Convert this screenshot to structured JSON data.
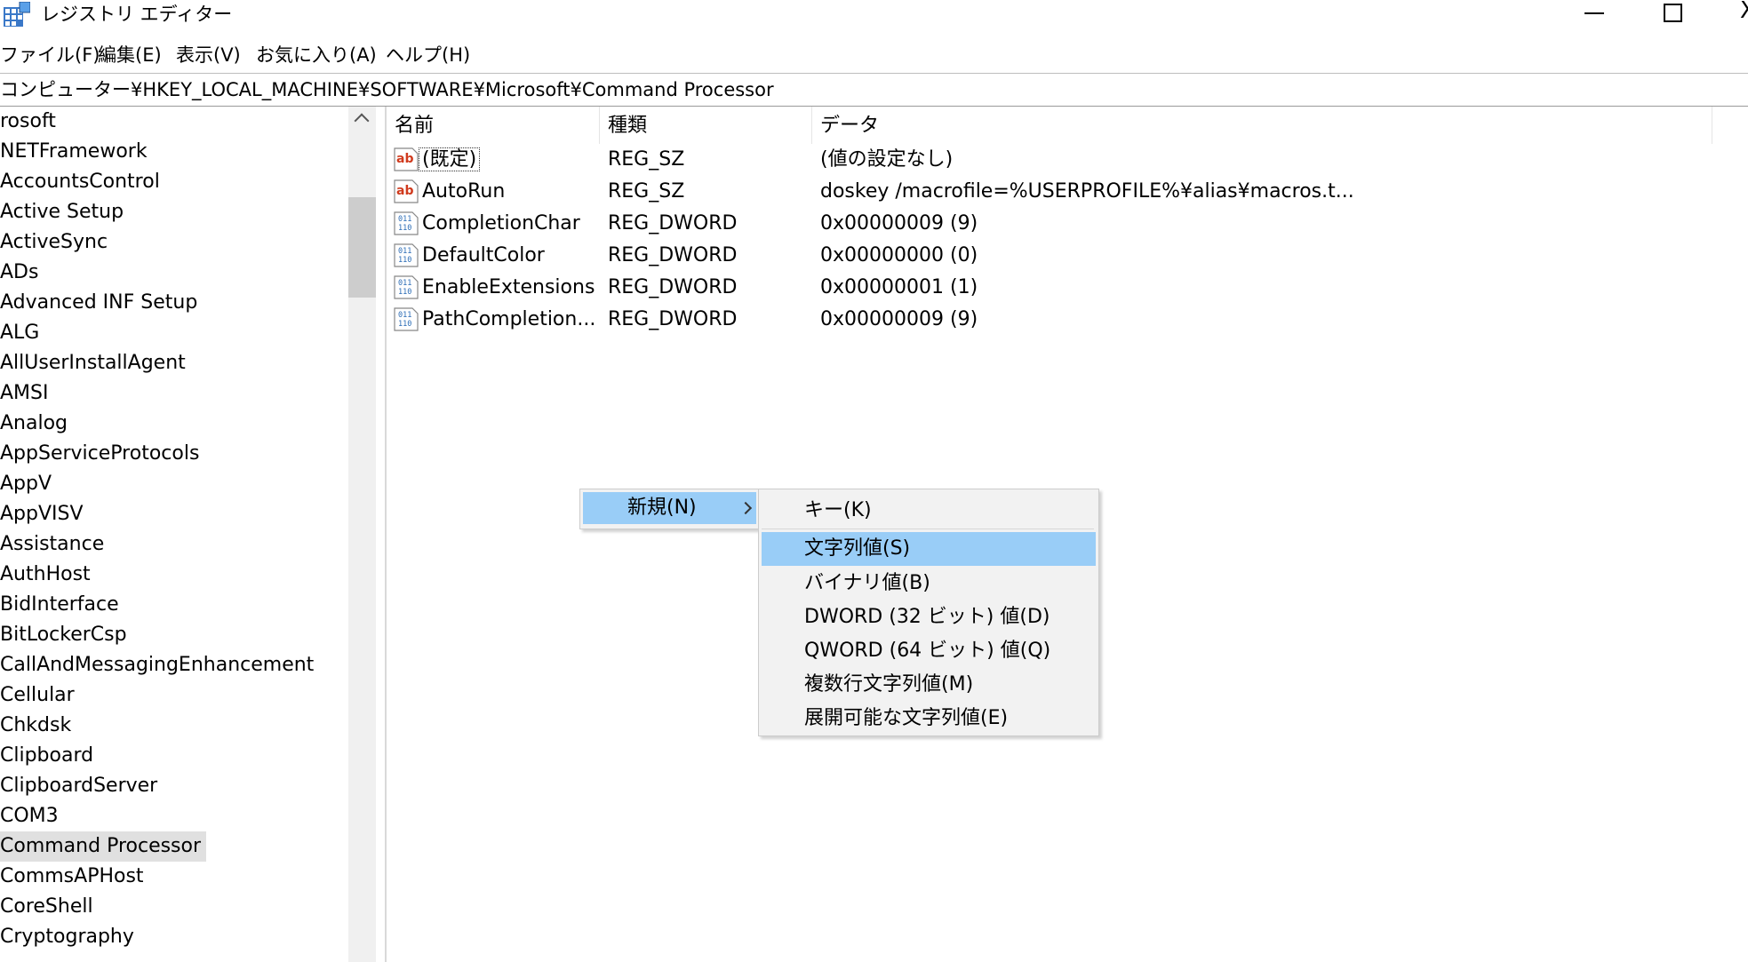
{
  "window": {
    "title": "レジストリ エディター",
    "close_glyph": "X"
  },
  "menu": [
    "ファイル(F)",
    "編集(E)",
    "表示(V)",
    "お気に入り(A)",
    "ヘルプ(H)"
  ],
  "address": "コンピューター¥HKEY_LOCAL_MACHINE¥SOFTWARE¥Microsoft¥Command Processor",
  "tree": {
    "items": [
      "rosoft",
      "NETFramework",
      "AccountsControl",
      "Active Setup",
      "ActiveSync",
      "ADs",
      "Advanced INF Setup",
      "ALG",
      "AllUserInstallAgent",
      "AMSI",
      "Analog",
      "AppServiceProtocols",
      "AppV",
      "AppVISV",
      "Assistance",
      "AuthHost",
      "BidInterface",
      "BitLockerCsp",
      "CallAndMessagingEnhancement",
      "Cellular",
      "Chkdsk",
      "Clipboard",
      "ClipboardServer",
      "COM3",
      "Command Processor",
      "CommsAPHost",
      "CoreShell",
      "Cryptography"
    ],
    "selected_index": 24
  },
  "list": {
    "columns": [
      "名前",
      "種類",
      "データ"
    ],
    "rows": [
      {
        "icon": "string-value-icon",
        "name": "(既定)",
        "type": "REG_SZ",
        "data": "(値の設定なし)"
      },
      {
        "icon": "string-value-icon",
        "name": "AutoRun",
        "type": "REG_SZ",
        "data": "doskey /macrofile=%USERPROFILE%¥alias¥macros.t..."
      },
      {
        "icon": "dword-value-icon",
        "name": "CompletionChar",
        "type": "REG_DWORD",
        "data": "0x00000009 (9)"
      },
      {
        "icon": "dword-value-icon",
        "name": "DefaultColor",
        "type": "REG_DWORD",
        "data": "0x00000000 (0)"
      },
      {
        "icon": "dword-value-icon",
        "name": "EnableExtensions",
        "type": "REG_DWORD",
        "data": "0x00000001 (1)"
      },
      {
        "icon": "dword-value-icon",
        "name": "PathCompletion...",
        "type": "REG_DWORD",
        "data": "0x00000009 (9)"
      }
    ]
  },
  "context_menu": {
    "new_label": "新規(N)",
    "submenu": [
      "キー(K)",
      "文字列値(S)",
      "バイナリ値(B)",
      "DWORD (32 ビット) 値(D)",
      "QWORD (64 ビット) 値(Q)",
      "複数行文字列値(M)",
      "展開可能な文字列値(E)"
    ],
    "highlighted_index": 1
  },
  "colors": {
    "highlight": "#99cdf7",
    "selected_tree": "#e0e0e0",
    "icon_red": "#d03b1e",
    "icon_blue": "#2b6cb6"
  }
}
